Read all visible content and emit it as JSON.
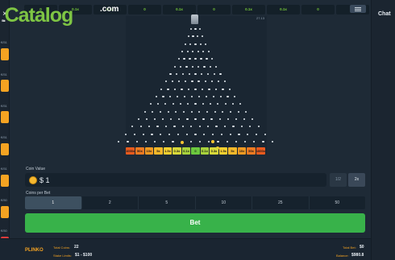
{
  "logo": {
    "part1": "Slot",
    "part2": "Catalog",
    "suffix": ".com"
  },
  "close_glyph": "×",
  "left_strip": {
    "labels": [
      "€/51",
      "€/51",
      "€/51",
      "€/51",
      "€/51",
      "€/50",
      "€/50"
    ],
    "tiles": [
      "orange",
      "orange",
      "orange",
      "orange",
      "orange",
      "orange",
      "red"
    ]
  },
  "history": [
    "0",
    "0.1x",
    "0.1x",
    "0",
    "0.1x",
    "0",
    "0.1x",
    "0.1x",
    "0",
    "0"
  ],
  "board_info": "27.13",
  "slots": [
    {
      "label": "1000x",
      "color": "#e85a1e"
    },
    {
      "label": "50x",
      "color": "#ef7a22"
    },
    {
      "label": "10x",
      "color": "#f39a22"
    },
    {
      "label": "5x",
      "color": "#f6b82a"
    },
    {
      "label": "1.5x",
      "color": "#f8d030"
    },
    {
      "label": "0.3x",
      "color": "#d8d83a"
    },
    {
      "label": "0.1x",
      "color": "#a8d23c"
    },
    {
      "label": "0",
      "color": "#6cc83e"
    },
    {
      "label": "0.1x",
      "color": "#a8d23c"
    },
    {
      "label": "0.3x",
      "color": "#d8d83a"
    },
    {
      "label": "1.5x",
      "color": "#f8d030"
    },
    {
      "label": "5x",
      "color": "#f6b82a"
    },
    {
      "label": "10x",
      "color": "#f39a22"
    },
    {
      "label": "50x",
      "color": "#ef7a22"
    },
    {
      "label": "1000x",
      "color": "#e85a1e"
    }
  ],
  "coin": {
    "label": "Coin Value",
    "value": "$ 1",
    "half": "1/2",
    "double": "2x"
  },
  "coins_per_bet": {
    "label": "Coins per Bet",
    "options": [
      "1",
      "2",
      "5",
      "10",
      "25",
      "50"
    ],
    "selected": "1"
  },
  "bet_label": "Bet",
  "footer": {
    "game_logo": "PLINKO",
    "total_coins_label": "Total Coins:",
    "total_coins_value": "22",
    "stake_limits_label": "Stake Limits:",
    "stake_limits_value": "$1 - $100",
    "total_bet_label": "Total Bet:",
    "total_bet_value": "$0",
    "balance_label": "Balance:",
    "balance_value": "$980.8"
  },
  "chat": {
    "title": "Chat"
  },
  "colors": {
    "accent_green": "#38b24a",
    "coin_gold": "#f4b830",
    "brand_orange": "#f4a322"
  }
}
